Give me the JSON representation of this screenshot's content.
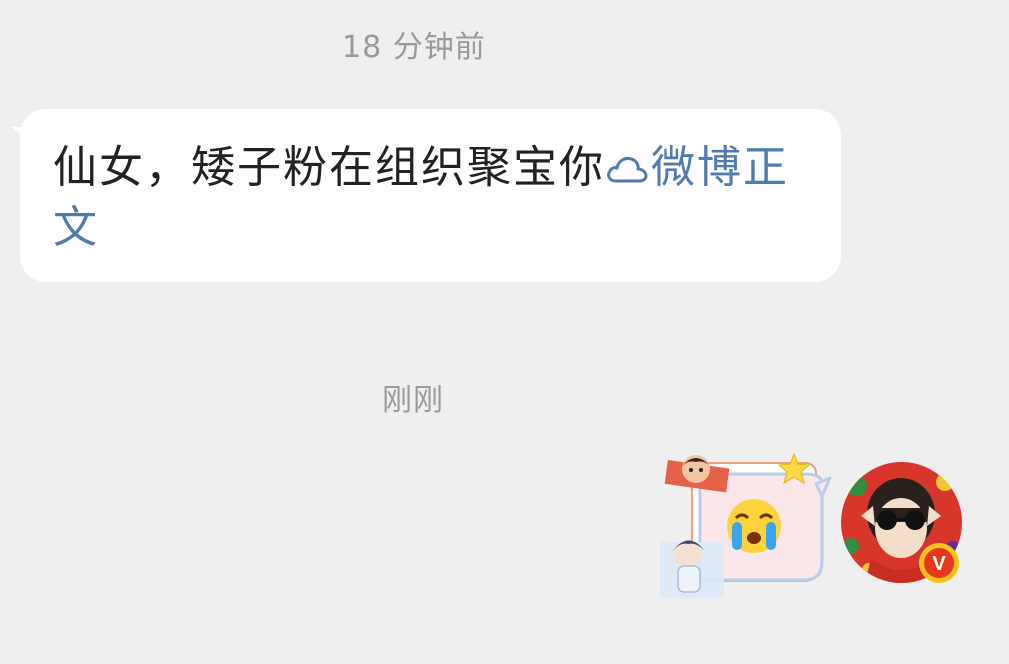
{
  "chat": {
    "timestamps": [
      "18 分钟前",
      "刚刚"
    ],
    "incoming_message": {
      "text": "仙女，矮子粉在组织聚宝你",
      "link_icon": "cloud-icon",
      "link_label": "微博正文"
    },
    "outgoing_sticker": {
      "icon": "crying-face-emoji",
      "decorations": [
        "star-icon",
        "character-sticker"
      ]
    },
    "user_avatar": {
      "icon": "avatar-girl-sunglasses",
      "badge": "V"
    }
  },
  "colors": {
    "background": "#efefef",
    "bubble": "#ffffff",
    "text": "#222222",
    "link": "#4f7cae",
    "timestamp": "#9a9a9a",
    "badge": "#e8361c"
  }
}
